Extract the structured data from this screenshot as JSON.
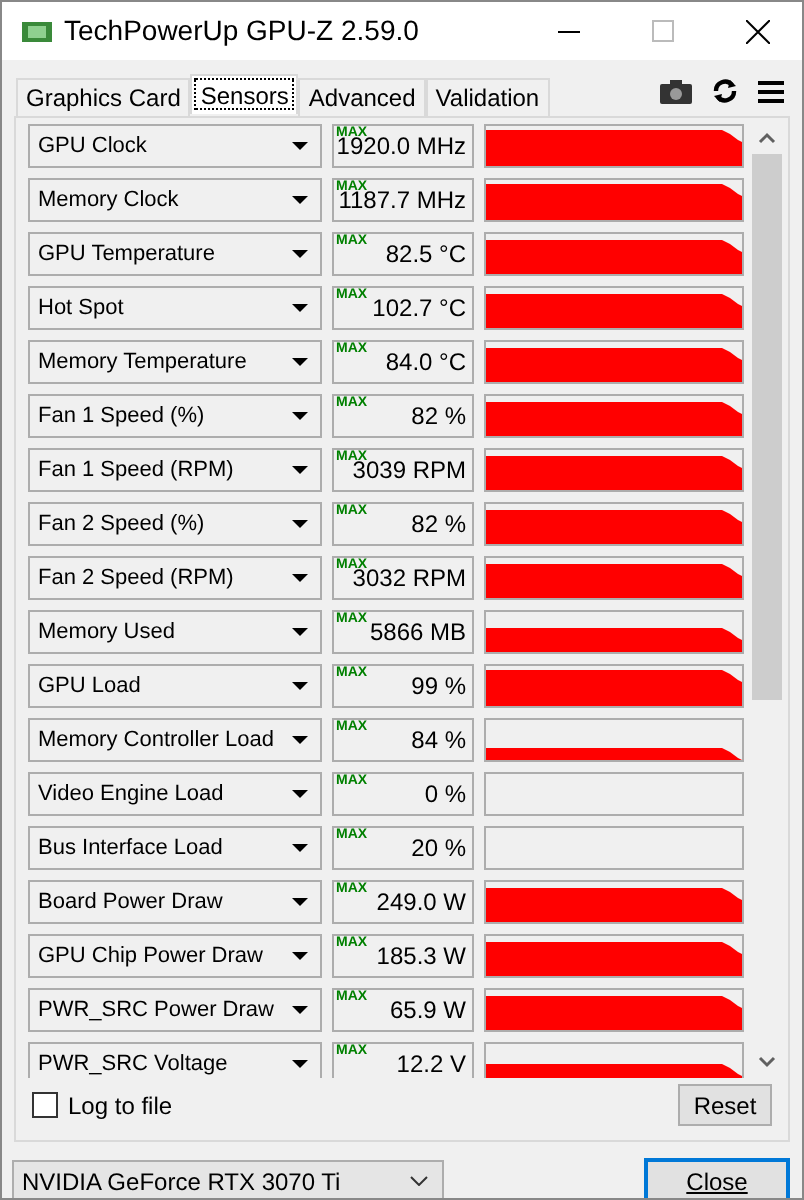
{
  "window": {
    "title": "TechPowerUp GPU-Z 2.59.0"
  },
  "tabs": [
    {
      "label": "Graphics Card",
      "selected": false
    },
    {
      "label": "Sensors",
      "selected": true
    },
    {
      "label": "Advanced",
      "selected": false
    },
    {
      "label": "Validation",
      "selected": false
    }
  ],
  "sensors": [
    {
      "name": "GPU Clock",
      "max_label": "MAX",
      "value": "1920.0 MHz",
      "kind": "graph"
    },
    {
      "name": "Memory Clock",
      "max_label": "MAX",
      "value": "1187.7 MHz",
      "kind": "graph"
    },
    {
      "name": "GPU Temperature",
      "max_label": "MAX",
      "value": "82.5 °C",
      "kind": "graph"
    },
    {
      "name": "Hot Spot",
      "max_label": "MAX",
      "value": "102.7 °C",
      "kind": "graph"
    },
    {
      "name": "Memory Temperature",
      "max_label": "MAX",
      "value": "84.0 °C",
      "kind": "graph"
    },
    {
      "name": "Fan 1 Speed (%)",
      "max_label": "MAX",
      "value": "82 %",
      "kind": "graph"
    },
    {
      "name": "Fan 1 Speed (RPM)",
      "max_label": "MAX",
      "value": "3039 RPM",
      "kind": "graph"
    },
    {
      "name": "Fan 2 Speed (%)",
      "max_label": "MAX",
      "value": "82 %",
      "kind": "graph"
    },
    {
      "name": "Fan 2 Speed (RPM)",
      "max_label": "MAX",
      "value": "3032 RPM",
      "kind": "graph"
    },
    {
      "name": "Memory Used",
      "max_label": "MAX",
      "value": "5866 MB",
      "kind": "graph"
    },
    {
      "name": "GPU Load",
      "max_label": "MAX",
      "value": "99 %",
      "kind": "graph"
    },
    {
      "name": "Memory Controller Load",
      "max_label": "MAX",
      "value": "84 %",
      "kind": "graph"
    },
    {
      "name": "Video Engine Load",
      "max_label": "MAX",
      "value": "0 %",
      "kind": "flat"
    },
    {
      "name": "Bus Interface Load",
      "max_label": "MAX",
      "value": "20 %",
      "kind": "flat"
    },
    {
      "name": "Board Power Draw",
      "max_label": "MAX",
      "value": "249.0 W",
      "kind": "graph"
    },
    {
      "name": "GPU Chip Power Draw",
      "max_label": "MAX",
      "value": "185.3 W",
      "kind": "graph"
    },
    {
      "name": "PWR_SRC Power Draw",
      "max_label": "MAX",
      "value": "65.9 W",
      "kind": "graph"
    },
    {
      "name": "PWR_SRC Voltage",
      "max_label": "MAX",
      "value": "12.2 V",
      "kind": "graph"
    }
  ],
  "log_to_file": {
    "label": "Log to file",
    "checked": false
  },
  "reset_button": "Reset",
  "gpu_select": {
    "value": "NVIDIA GeForce RTX 3070 Ti"
  },
  "close_button": "Close"
}
